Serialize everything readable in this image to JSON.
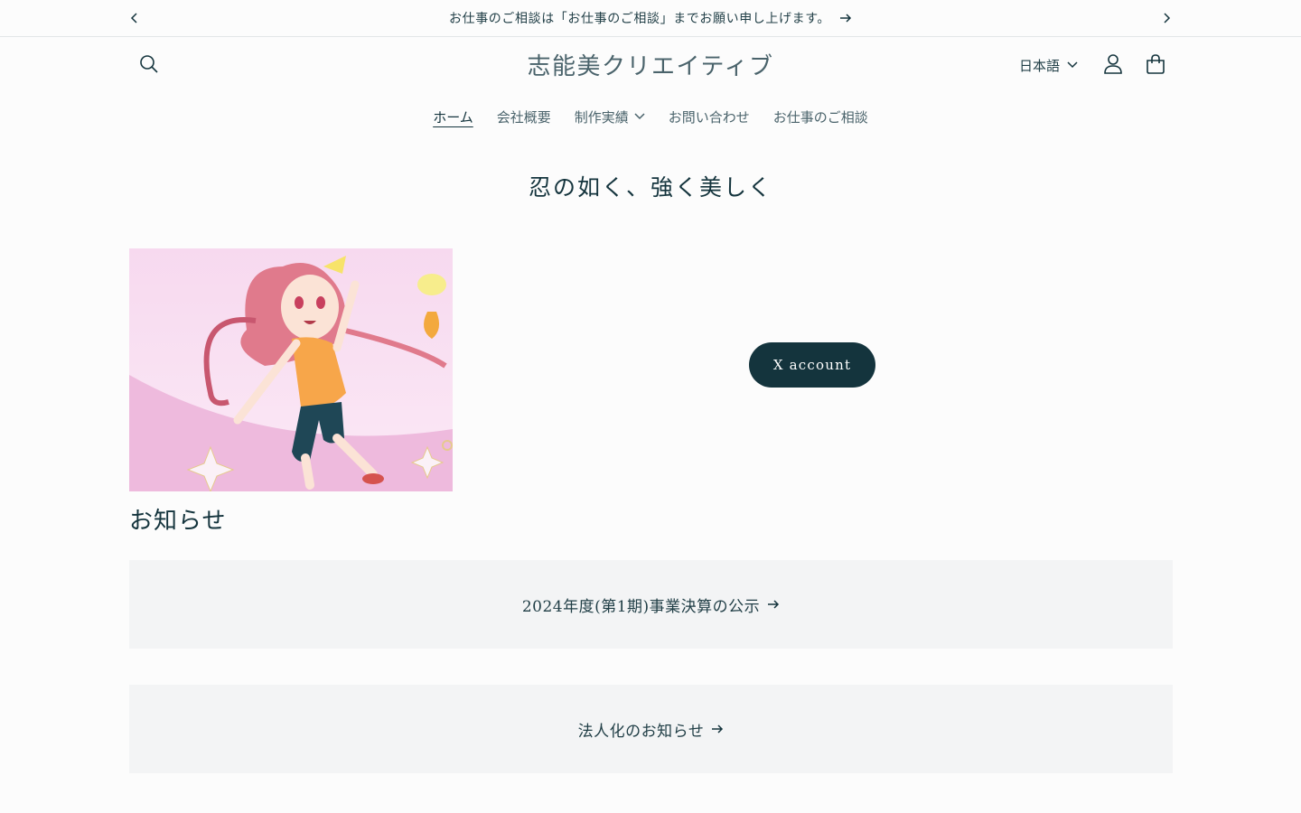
{
  "announcement": {
    "text": "お仕事のご相談は「お仕事のご相談」までお願い申し上げます。"
  },
  "header": {
    "logo": "志能美クリエイティブ",
    "language": "日本語"
  },
  "nav": {
    "items": [
      {
        "label": "ホーム"
      },
      {
        "label": "会社概要"
      },
      {
        "label": "制作実績"
      },
      {
        "label": "お問い合わせ"
      },
      {
        "label": "お仕事のご相談"
      }
    ]
  },
  "hero": {
    "title": "忍の如く、強く美しく"
  },
  "social": {
    "x_button": "X account"
  },
  "news": {
    "title": "お知らせ",
    "items": [
      {
        "label": "2024年度(第1期)事業決算の公示"
      },
      {
        "label": "法人化のお知らせ"
      }
    ]
  },
  "colors": {
    "primary": "#14343d",
    "background": "#fcfcfc",
    "card": "#f3f4f5"
  }
}
